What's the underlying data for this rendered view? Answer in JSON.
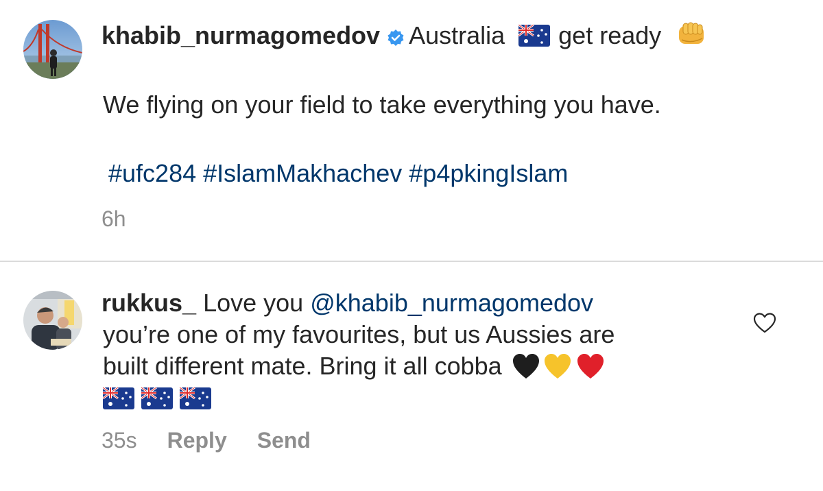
{
  "post": {
    "username": "khabib_nurmagomedov",
    "caption_head_1": "Australia",
    "caption_head_2": "get ready",
    "caption_body": "We flying on your field to take everything you have.",
    "hashtags": [
      "#ufc284",
      "#IslamMakhachev",
      "#p4pkingIslam"
    ],
    "time": "6h",
    "icons": {
      "verified": "verified-badge-icon",
      "flag": "australia-flag-icon",
      "fist": "oncoming-fist-emoji"
    }
  },
  "comment": {
    "username": "rukkus_",
    "text_1": "Love you",
    "mention": "@khabib_nurmagomedov",
    "text_2": "you’re one of my favourites, but us Aussies are",
    "text_3": "built different mate. Bring it all cobba",
    "emojis": [
      "black-heart-emoji",
      "yellow-heart-emoji",
      "red-heart-emoji"
    ],
    "flags": [
      "australia-flag-icon",
      "australia-flag-icon",
      "australia-flag-icon"
    ],
    "time": "35s",
    "reply_label": "Reply",
    "send_label": "Send"
  },
  "colors": {
    "text": "#262626",
    "link": "#00376b",
    "meta": "#8e8e8e",
    "verified": "#3897f0",
    "divider": "#dbdbdb"
  }
}
